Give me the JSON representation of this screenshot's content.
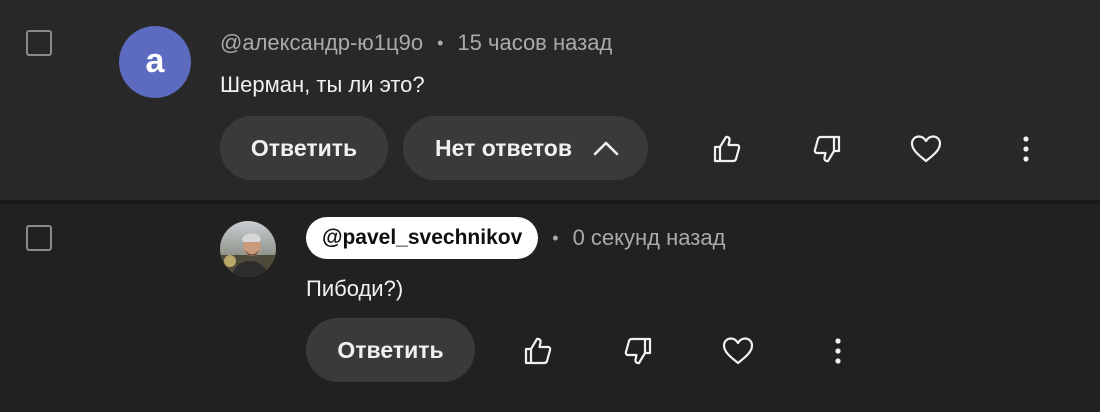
{
  "comments": [
    {
      "avatar_letter": "а",
      "author": "@александр-ю1ц9о",
      "separator": "•",
      "time": "15 часов назад",
      "text": "Шерман, ты ли это?",
      "reply_label": "Ответить",
      "replies_label": "Нет ответов",
      "icons": [
        "like-icon",
        "dislike-icon",
        "heart-icon",
        "more-vert-icon"
      ]
    },
    {
      "author": "@pavel_svechnikov",
      "separator": "•",
      "time": "0 секунд назад",
      "text": "Пибоди?)",
      "reply_label": "Ответить",
      "icons": [
        "like-icon",
        "dislike-icon",
        "heart-icon",
        "more-vert-icon"
      ]
    }
  ],
  "colors": {
    "avatar_bg": "#5c6bc0",
    "button_bg": "#3a3a3a",
    "muted_text": "#aaaaaa"
  }
}
